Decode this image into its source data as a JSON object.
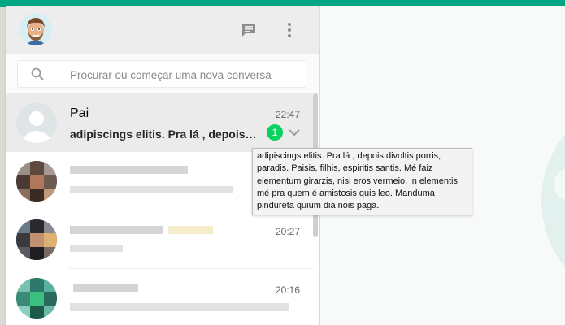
{
  "colors": {
    "brand_band": "#00a783",
    "badge": "#09d261",
    "active_row": "#ebebeb",
    "header": "#ededed"
  },
  "header": {
    "icons": [
      "new-chat-icon",
      "menu-icon"
    ]
  },
  "search": {
    "placeholder": "Procurar ou começar uma nova conversa",
    "icon": "search-icon"
  },
  "chats": [
    {
      "name": "Pai",
      "time": "22:47",
      "preview": "adipiscings elitis. Pra lá , depois divoltis porris,",
      "unread": "1"
    },
    {
      "time": ""
    },
    {
      "time": "20:27"
    },
    {
      "time": "20:16"
    }
  ],
  "tooltip": {
    "text": "adipiscings elitis. Pra lá , depois divoltis porris, paradis. Paisis, filhis, espiritis santis. Mé faiz elementum girarzis, nisi eros vermeio, in elementis mé pra quem é amistosis quis leo. Manduma pindureta quium dia nois paga."
  }
}
